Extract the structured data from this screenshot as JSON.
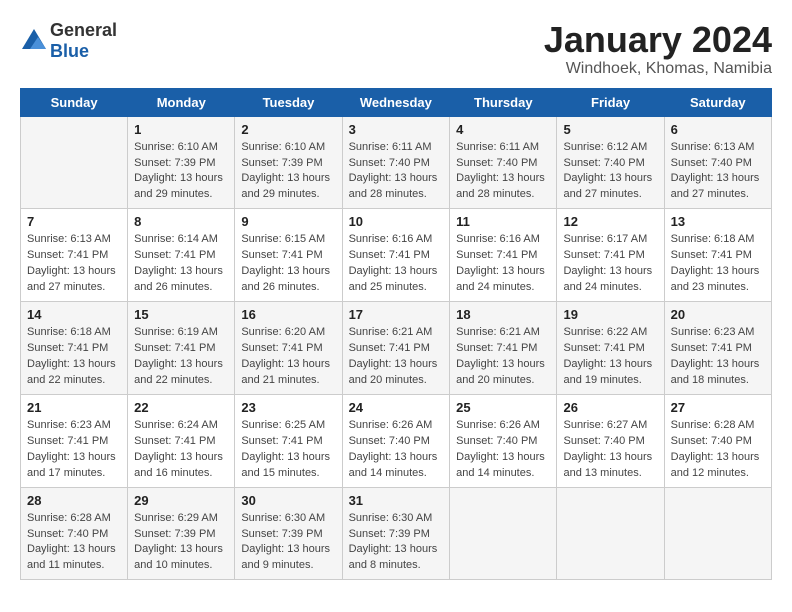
{
  "header": {
    "logo_general": "General",
    "logo_blue": "Blue",
    "main_title": "January 2024",
    "subtitle": "Windhoek, Khomas, Namibia"
  },
  "calendar": {
    "days_of_week": [
      "Sunday",
      "Monday",
      "Tuesday",
      "Wednesday",
      "Thursday",
      "Friday",
      "Saturday"
    ],
    "weeks": [
      [
        {
          "day": "",
          "info": ""
        },
        {
          "day": "1",
          "info": "Sunrise: 6:10 AM\nSunset: 7:39 PM\nDaylight: 13 hours\nand 29 minutes."
        },
        {
          "day": "2",
          "info": "Sunrise: 6:10 AM\nSunset: 7:39 PM\nDaylight: 13 hours\nand 29 minutes."
        },
        {
          "day": "3",
          "info": "Sunrise: 6:11 AM\nSunset: 7:40 PM\nDaylight: 13 hours\nand 28 minutes."
        },
        {
          "day": "4",
          "info": "Sunrise: 6:11 AM\nSunset: 7:40 PM\nDaylight: 13 hours\nand 28 minutes."
        },
        {
          "day": "5",
          "info": "Sunrise: 6:12 AM\nSunset: 7:40 PM\nDaylight: 13 hours\nand 27 minutes."
        },
        {
          "day": "6",
          "info": "Sunrise: 6:13 AM\nSunset: 7:40 PM\nDaylight: 13 hours\nand 27 minutes."
        }
      ],
      [
        {
          "day": "7",
          "info": "Sunrise: 6:13 AM\nSunset: 7:41 PM\nDaylight: 13 hours\nand 27 minutes."
        },
        {
          "day": "8",
          "info": "Sunrise: 6:14 AM\nSunset: 7:41 PM\nDaylight: 13 hours\nand 26 minutes."
        },
        {
          "day": "9",
          "info": "Sunrise: 6:15 AM\nSunset: 7:41 PM\nDaylight: 13 hours\nand 26 minutes."
        },
        {
          "day": "10",
          "info": "Sunrise: 6:16 AM\nSunset: 7:41 PM\nDaylight: 13 hours\nand 25 minutes."
        },
        {
          "day": "11",
          "info": "Sunrise: 6:16 AM\nSunset: 7:41 PM\nDaylight: 13 hours\nand 24 minutes."
        },
        {
          "day": "12",
          "info": "Sunrise: 6:17 AM\nSunset: 7:41 PM\nDaylight: 13 hours\nand 24 minutes."
        },
        {
          "day": "13",
          "info": "Sunrise: 6:18 AM\nSunset: 7:41 PM\nDaylight: 13 hours\nand 23 minutes."
        }
      ],
      [
        {
          "day": "14",
          "info": "Sunrise: 6:18 AM\nSunset: 7:41 PM\nDaylight: 13 hours\nand 22 minutes."
        },
        {
          "day": "15",
          "info": "Sunrise: 6:19 AM\nSunset: 7:41 PM\nDaylight: 13 hours\nand 22 minutes."
        },
        {
          "day": "16",
          "info": "Sunrise: 6:20 AM\nSunset: 7:41 PM\nDaylight: 13 hours\nand 21 minutes."
        },
        {
          "day": "17",
          "info": "Sunrise: 6:21 AM\nSunset: 7:41 PM\nDaylight: 13 hours\nand 20 minutes."
        },
        {
          "day": "18",
          "info": "Sunrise: 6:21 AM\nSunset: 7:41 PM\nDaylight: 13 hours\nand 20 minutes."
        },
        {
          "day": "19",
          "info": "Sunrise: 6:22 AM\nSunset: 7:41 PM\nDaylight: 13 hours\nand 19 minutes."
        },
        {
          "day": "20",
          "info": "Sunrise: 6:23 AM\nSunset: 7:41 PM\nDaylight: 13 hours\nand 18 minutes."
        }
      ],
      [
        {
          "day": "21",
          "info": "Sunrise: 6:23 AM\nSunset: 7:41 PM\nDaylight: 13 hours\nand 17 minutes."
        },
        {
          "day": "22",
          "info": "Sunrise: 6:24 AM\nSunset: 7:41 PM\nDaylight: 13 hours\nand 16 minutes."
        },
        {
          "day": "23",
          "info": "Sunrise: 6:25 AM\nSunset: 7:41 PM\nDaylight: 13 hours\nand 15 minutes."
        },
        {
          "day": "24",
          "info": "Sunrise: 6:26 AM\nSunset: 7:40 PM\nDaylight: 13 hours\nand 14 minutes."
        },
        {
          "day": "25",
          "info": "Sunrise: 6:26 AM\nSunset: 7:40 PM\nDaylight: 13 hours\nand 14 minutes."
        },
        {
          "day": "26",
          "info": "Sunrise: 6:27 AM\nSunset: 7:40 PM\nDaylight: 13 hours\nand 13 minutes."
        },
        {
          "day": "27",
          "info": "Sunrise: 6:28 AM\nSunset: 7:40 PM\nDaylight: 13 hours\nand 12 minutes."
        }
      ],
      [
        {
          "day": "28",
          "info": "Sunrise: 6:28 AM\nSunset: 7:40 PM\nDaylight: 13 hours\nand 11 minutes."
        },
        {
          "day": "29",
          "info": "Sunrise: 6:29 AM\nSunset: 7:39 PM\nDaylight: 13 hours\nand 10 minutes."
        },
        {
          "day": "30",
          "info": "Sunrise: 6:30 AM\nSunset: 7:39 PM\nDaylight: 13 hours\nand 9 minutes."
        },
        {
          "day": "31",
          "info": "Sunrise: 6:30 AM\nSunset: 7:39 PM\nDaylight: 13 hours\nand 8 minutes."
        },
        {
          "day": "",
          "info": ""
        },
        {
          "day": "",
          "info": ""
        },
        {
          "day": "",
          "info": ""
        }
      ]
    ]
  }
}
